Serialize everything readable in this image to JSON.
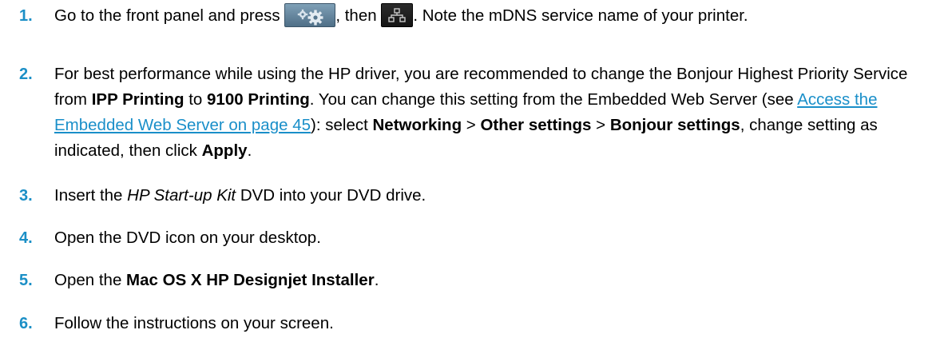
{
  "steps": [
    {
      "number": "1.",
      "pre": "Go to the front panel and press ",
      "icon_a": "settings-gears-icon",
      "mid": ", then ",
      "icon_b": "network-icon",
      "post": ". Note the mDNS service name of your printer."
    },
    {
      "number": "2.",
      "t1": "For best performance while using the HP driver, you are recommended to change the Bonjour Highest Priority Service from ",
      "b1": "IPP Printing",
      "t2": " to ",
      "b2": "9100 Printing",
      "t3": ". You can change this setting from the Embedded Web Server (see ",
      "link": "Access the Embedded Web Server on page 45",
      "t4": "): select ",
      "b3": "Networking",
      "t5": " > ",
      "b4": "Other settings",
      "t6": " > ",
      "b5": "Bonjour settings",
      "t7": ", change setting as indicated, then click ",
      "b6": "Apply",
      "t8": "."
    },
    {
      "number": "3.",
      "pre": "Insert the ",
      "italic": "HP Start-up Kit",
      "post": " DVD into your DVD drive."
    },
    {
      "number": "4.",
      "text": "Open the DVD icon on your desktop."
    },
    {
      "number": "5.",
      "pre": "Open the ",
      "bold": "Mac OS X HP Designjet Installer",
      "post": "."
    },
    {
      "number": "6.",
      "text": "Follow the instructions on your screen."
    }
  ],
  "colors": {
    "step_number": "#1b8fc6",
    "link": "#1a8fc9",
    "settings_key": "#5f7f96",
    "network_key": "#1c1c1c"
  }
}
